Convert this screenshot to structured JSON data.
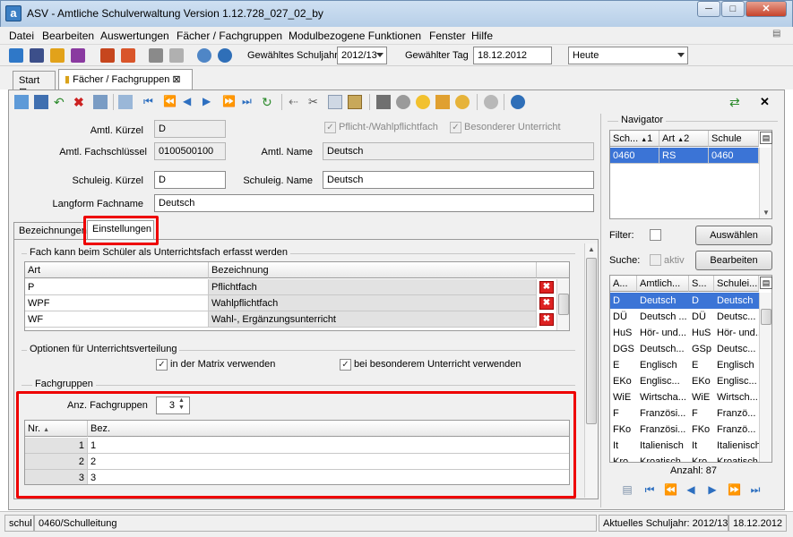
{
  "window": {
    "title": "ASV - Amtliche Schulverwaltung Version 1.12.728_027_02_by",
    "app_icon": "a"
  },
  "menu": [
    "Datei",
    "Bearbeiten",
    "Auswertungen",
    "Fächer / Fachgruppen",
    "Modulbezogene Funktionen",
    "Fenster",
    "Hilfe"
  ],
  "toolbar": {
    "schuljahr_label": "Gewähltes Schuljahr",
    "schuljahr_value": "2012/13",
    "tag_label": "Gewählter Tag",
    "tag_value": "18.12.2012",
    "heute_value": "Heute"
  },
  "tabs": [
    {
      "label": "Start"
    },
    {
      "label": "Fächer / Fachgruppen"
    }
  ],
  "form": {
    "amtl_kuerzel_label": "Amtl. Kürzel",
    "amtl_kuerzel": "D",
    "pflicht_label": "Pflicht-/Wahlpflichtfach",
    "besonderer_label": "Besonderer Unterricht",
    "fachschluessel_label": "Amtl.  Fachschlüssel",
    "fachschluessel": "0100500100",
    "amtl_name_label": "Amtl. Name",
    "amtl_name": "Deutsch",
    "schuleig_kuerzel_label": "Schuleig. Kürzel",
    "schuleig_kuerzel": "D",
    "schuleig_name_label": "Schuleig. Name",
    "schuleig_name": "Deutsch",
    "langform_label": "Langform Fachname",
    "langform": "Deutsch"
  },
  "subtabs": [
    "Bezeichnungen",
    "Einstellungen"
  ],
  "unterrichtsfach": {
    "title": "Fach kann beim Schüler als Unterrichtsfach erfasst werden",
    "columns": [
      "Art",
      "Bezeichnung"
    ],
    "rows": [
      [
        "P",
        "Pflichtfach"
      ],
      [
        "WPF",
        "Wahlpflichtfach"
      ],
      [
        "WF",
        "Wahl-, Ergänzungsunterricht"
      ]
    ]
  },
  "optionen": {
    "title": "Optionen für Unterrichtsverteilung",
    "matrix_label": "in der Matrix verwenden",
    "besonderer_label": "bei besonderem Unterricht verwenden"
  },
  "fachgruppen": {
    "title": "Fachgruppen",
    "anz_label": "Anz. Fachgruppen",
    "anz_value": "3",
    "columns": [
      "Nr.",
      "Bez."
    ],
    "rows": [
      [
        "1",
        "1"
      ],
      [
        "2",
        "2"
      ],
      [
        "3",
        "3"
      ]
    ]
  },
  "navigator": {
    "title": "Navigator",
    "columns": [
      "Sch...",
      "1",
      "Art",
      "2",
      "Schule"
    ],
    "row": [
      "0460",
      "RS",
      "0460"
    ],
    "filter_label": "Filter:",
    "auswaehlen": "Auswählen",
    "suche_label": "Suche:",
    "aktiv_label": "aktiv",
    "bearbeiten": "Bearbeiten",
    "list_columns": [
      "A...",
      "Amtlich...",
      "S...",
      "Schulei..."
    ],
    "list": [
      [
        "D",
        "Deutsch",
        "D",
        "Deutsch"
      ],
      [
        "DÜ",
        "Deutsch ...",
        "DÜ",
        "Deutsc..."
      ],
      [
        "HuS",
        "Hör- und...",
        "HuS",
        "Hör- und..."
      ],
      [
        "DGS",
        "Deutsch...",
        "GSp",
        "Deutsc..."
      ],
      [
        "E",
        "Englisch",
        "E",
        "Englisch"
      ],
      [
        "EKo",
        "Englisc...",
        "EKo",
        "Englisc..."
      ],
      [
        "WiE",
        "Wirtscha...",
        "WiE",
        "Wirtsch..."
      ],
      [
        "F",
        "Französi...",
        "F",
        "Franzö..."
      ],
      [
        "FKo",
        "Französi...",
        "FKo",
        "Franzö..."
      ],
      [
        "It",
        "Italienisch",
        "It",
        "Italienisch"
      ],
      [
        "Kro",
        "Kroatisch",
        "Kro",
        "Kroatisch"
      ]
    ],
    "anzahl": "Anzahl: 87"
  },
  "status": {
    "left1": "schul",
    "left2": "0460/Schulleitung",
    "schuljahr": "Aktuelles Schuljahr: 2012/13",
    "date": "18.12.2012"
  },
  "colors": {
    "accent": "#3b74d6",
    "highlight": "#e00000"
  }
}
